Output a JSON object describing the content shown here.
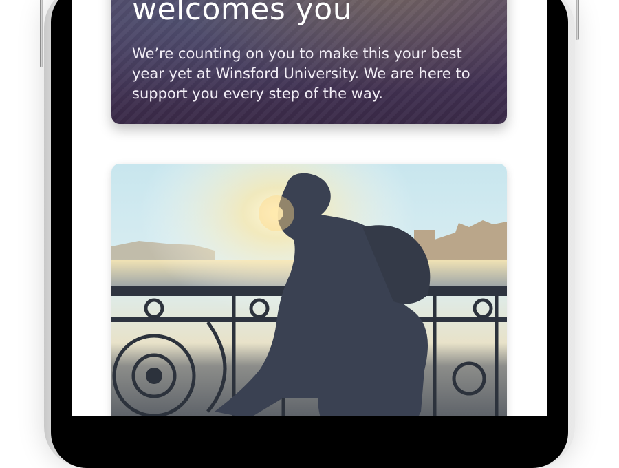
{
  "welcome": {
    "title": "welcomes you",
    "body": "We’re counting on you to make this your best year yet at Winsford University. We are here to support you every step of the way."
  },
  "photo": {
    "subject": "cyclist-on-bridge-image"
  }
}
